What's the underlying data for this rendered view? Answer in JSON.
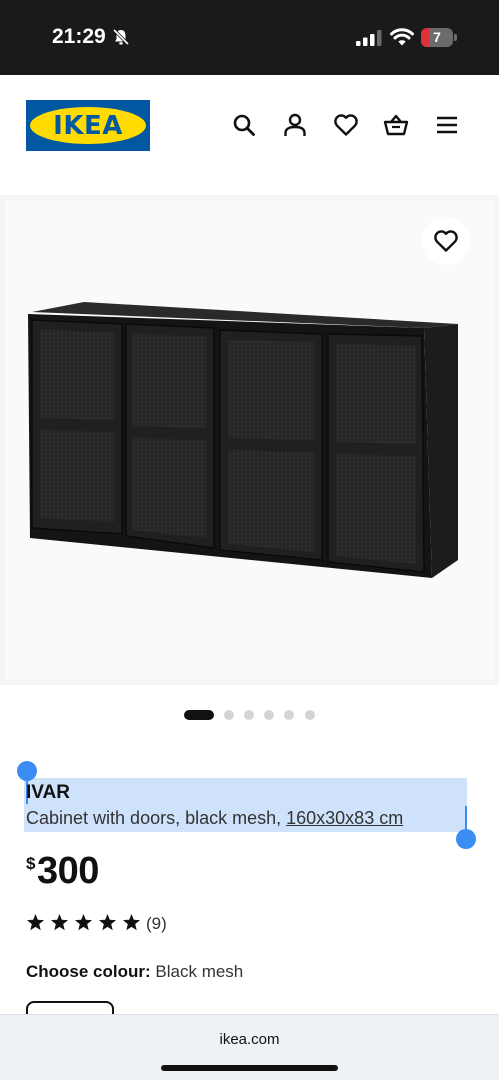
{
  "status_bar": {
    "time": "21:29",
    "battery_level": "7",
    "battery_color": "#e0313b"
  },
  "header": {
    "logo_text": "IKEA",
    "brand_colors": {
      "blue": "#0058a3",
      "yellow": "#ffdb00"
    },
    "icons": [
      "search-icon",
      "account-icon",
      "favourites-icon",
      "shopping-bag-icon",
      "menu-icon"
    ]
  },
  "gallery": {
    "image": "black-mesh-cabinet-icon",
    "favourite_icon": "heart-icon",
    "image_count": 6,
    "active_index": 0
  },
  "product": {
    "name": "IVAR",
    "description": "Cabinet with doors, black mesh, ",
    "size": "160x30x83 cm",
    "currency": "$",
    "price": "300",
    "rating": 5,
    "rating_max": 5,
    "review_count": "(9)",
    "colour_label": "Choose colour:",
    "colour_value": " Black mesh"
  },
  "browser": {
    "url": "ikea.com"
  }
}
